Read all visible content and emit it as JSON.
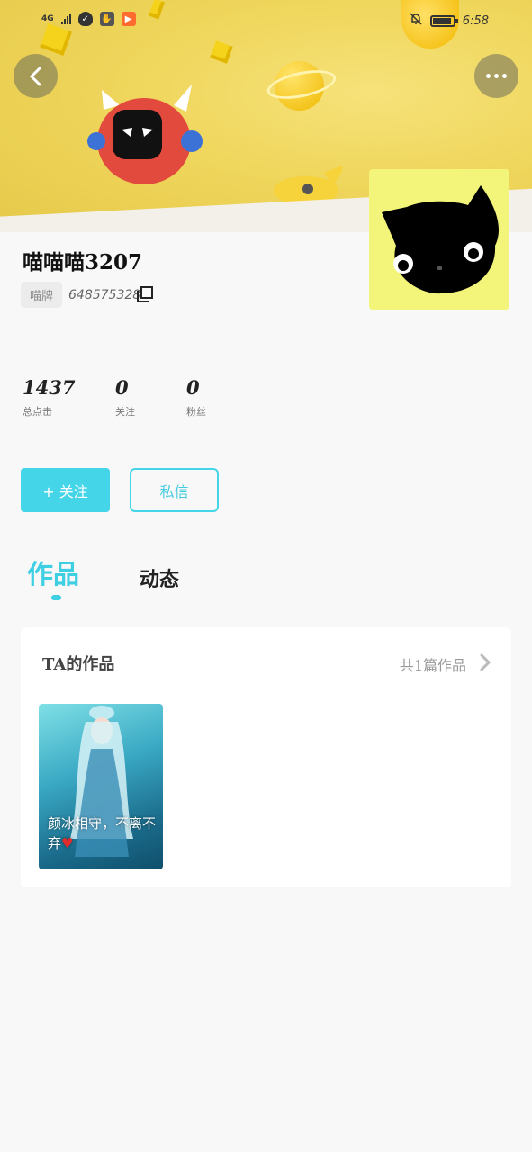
{
  "status_bar": {
    "network": "4G",
    "time": "6:58",
    "battery_level": 0.9
  },
  "profile": {
    "username": "喵喵喵3207",
    "badge": "喵牌",
    "uid": "648575328"
  },
  "stats": [
    {
      "value": "1437",
      "label": "总点击"
    },
    {
      "value": "0",
      "label": "关注"
    },
    {
      "value": "0",
      "label": "粉丝"
    }
  ],
  "actions": {
    "follow": "+ 关注",
    "message": "私信"
  },
  "tabs": [
    {
      "label": "作品",
      "active": true
    },
    {
      "label": "动态",
      "active": false
    }
  ],
  "works": {
    "title": "TA的作品",
    "count_label": "共1篇作品",
    "items": [
      {
        "caption": "颜冰相守，不离不弃",
        "heart": "♥"
      }
    ]
  },
  "colors": {
    "accent": "#45d5e8",
    "banner": "#efd65c",
    "avatar_bg": "#f3f57a"
  },
  "icons": {
    "back": "chevron-left-icon",
    "more": "more-dots-icon",
    "copy": "copy-icon",
    "chevron": "chevron-right-icon"
  }
}
